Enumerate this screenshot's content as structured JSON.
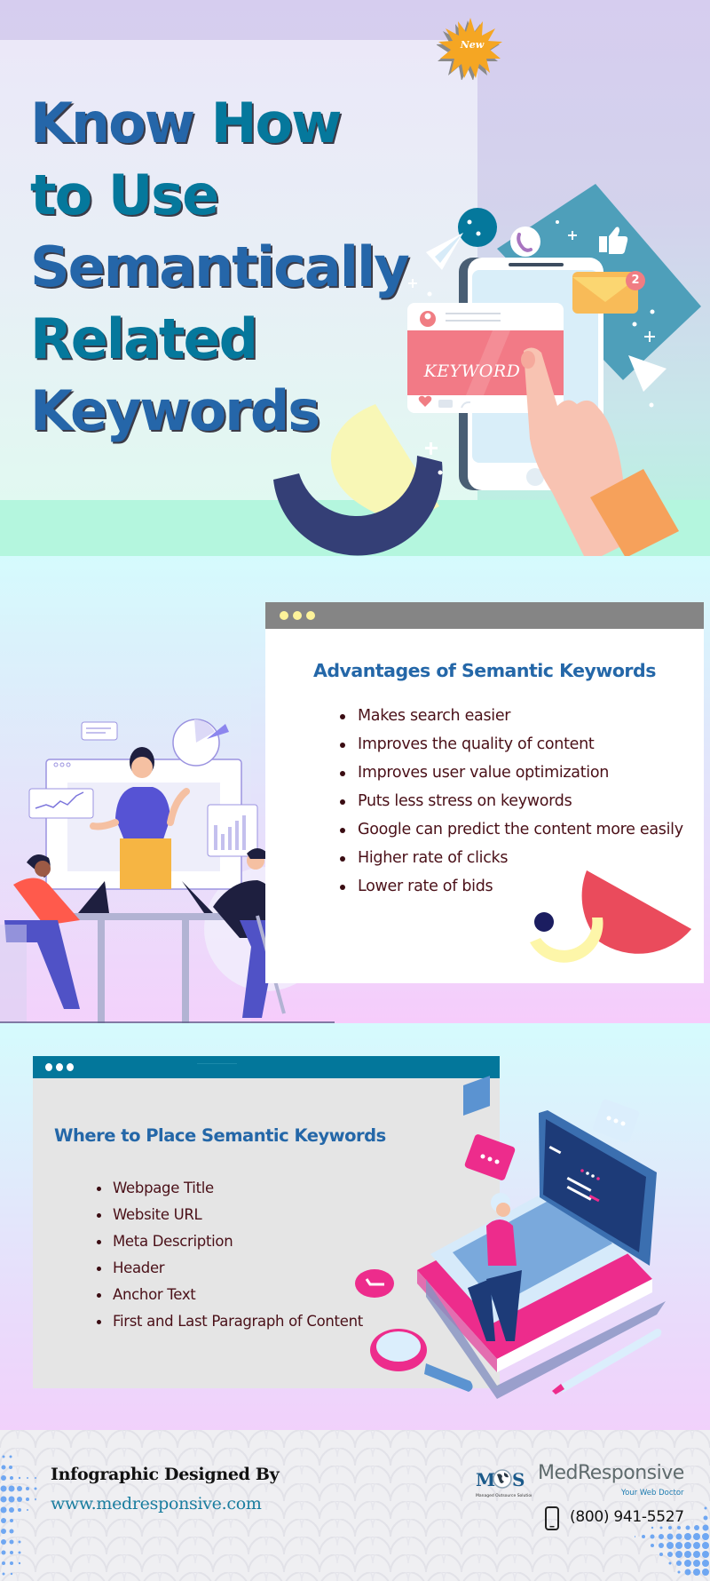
{
  "hero": {
    "badge": "New",
    "title_lines": [
      {
        "parts": [
          {
            "text": "Know ",
            "tone": "blue"
          },
          {
            "text": "How",
            "tone": "teal"
          }
        ]
      },
      {
        "parts": [
          {
            "text": "to Use",
            "tone": "teal"
          }
        ]
      },
      {
        "parts": [
          {
            "text": "Semantically",
            "tone": "blue"
          }
        ]
      },
      {
        "parts": [
          {
            "text": "Related",
            "tone": "teal"
          }
        ]
      },
      {
        "parts": [
          {
            "text": "Keywords",
            "tone": "blue"
          }
        ]
      }
    ],
    "illustration": {
      "card_text": "KEYWORD",
      "mail_badge_count": "2"
    }
  },
  "advantages": {
    "heading": "Advantages of Semantic Keywords",
    "items": [
      "Makes search easier",
      "Improves the quality of content",
      "Improves user value optimization",
      "Puts less stress on keywords",
      "Google can predict the content more easily",
      "Higher rate of clicks",
      "Lower rate of bids"
    ]
  },
  "placement": {
    "heading": "Where to Place Semantic Keywords",
    "items": [
      "Webpage Title",
      "Website URL",
      "Meta Description",
      "Header",
      "Anchor Text",
      "First and Last Paragraph of Content"
    ]
  },
  "footer": {
    "designed_by": "Infographic Designed By",
    "website": "www.medresponsive.com",
    "logo_text": "MOS",
    "logo_subtext": "Managed Outsource Solutions",
    "brand_name": "MedResponsive",
    "brand_tagline": "Your Web Doctor",
    "phone": "(800) 941-5527"
  },
  "colors": {
    "title_blue": "#2566a9",
    "title_teal": "#05789c",
    "heading_blue": "#2467a8",
    "list_text": "#4a1018",
    "card2_bar": "#858585",
    "card3_bar": "#03779b",
    "badge_orange": "#f5a623"
  }
}
